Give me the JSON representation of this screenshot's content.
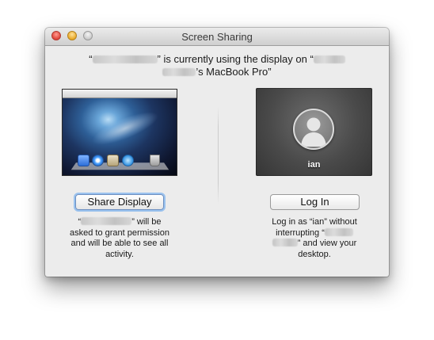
{
  "window": {
    "title": "Screen Sharing"
  },
  "message": {
    "part1": "“",
    "part2": "” is currently using the display on “",
    "part3": "’s MacBook Pro”"
  },
  "share": {
    "button_label": "Share Display",
    "desc_line1_open": "“",
    "desc_line1_close": "” will be",
    "desc_line2": "asked to grant permission",
    "desc_line3": "and will be able to see all",
    "desc_line4": "activity."
  },
  "login": {
    "button_label": "Log In",
    "username": "ian",
    "desc_line1": "Log in as “ian” without",
    "desc_line2_open": "interrupting “",
    "desc_line3_close": "” and view your",
    "desc_line4": "desktop."
  },
  "icons": {
    "apple": "",
    "desktop_thumbnail": "desktop-preview-icon",
    "user_avatar": "user-silhouette-icon"
  },
  "colors": {
    "focus_ring": "#9ac2ee",
    "window_bg": "#ececec"
  }
}
